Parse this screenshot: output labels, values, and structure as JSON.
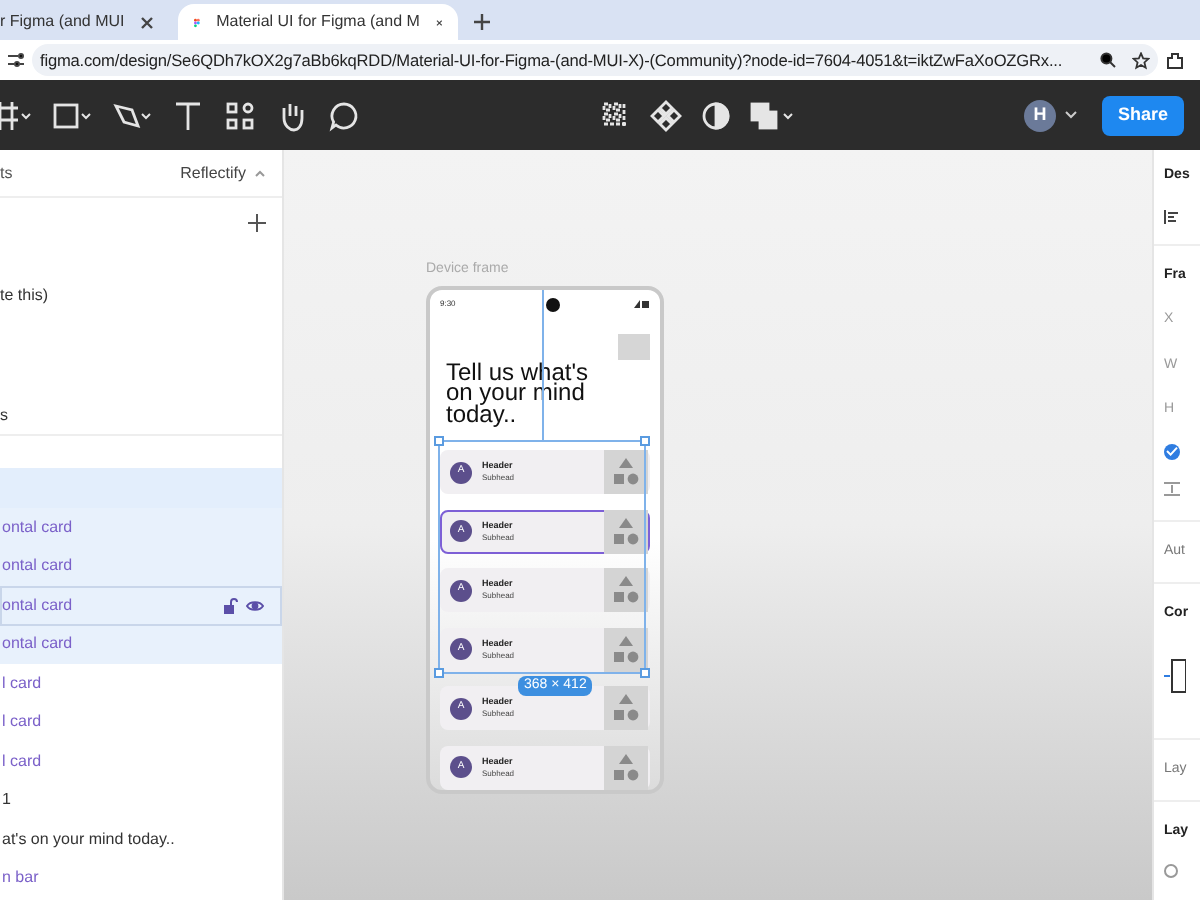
{
  "browser": {
    "tabs": [
      {
        "title": "r Figma (and MUI",
        "selected": false
      },
      {
        "title": "Material UI for Figma (and M",
        "selected": true
      }
    ],
    "url": "figma.com/design/Se6QDh7kOX2g7aBb6kqRDD/Material-UI-for-Figma-(and-MUI-X)-(Community)?node-id=7604-4051&t=iktZwFaXoOZGRx..."
  },
  "toolbar": {
    "avatar": "H",
    "share": "Share"
  },
  "left_panel": {
    "header": "ts",
    "team": "Reflectify",
    "pages": [
      "te this)",
      "s"
    ],
    "layers": [
      {
        "label": "ontal card",
        "kind": "component",
        "selected": true,
        "hovered": false
      },
      {
        "label": "ontal card",
        "kind": "component",
        "selected": true,
        "hovered": false
      },
      {
        "label": "ontal card",
        "kind": "component",
        "selected": true,
        "hovered": true
      },
      {
        "label": "ontal card",
        "kind": "component",
        "selected": true,
        "hovered": false
      },
      {
        "label": "l card",
        "kind": "component",
        "selected": false,
        "hovered": false
      },
      {
        "label": "l card",
        "kind": "component",
        "selected": false,
        "hovered": false
      },
      {
        "label": "l card",
        "kind": "component",
        "selected": false,
        "hovered": false
      },
      {
        "label": "1",
        "kind": "frame",
        "selected": false,
        "hovered": false
      },
      {
        "label": "at's on your mind today..",
        "kind": "text",
        "selected": false,
        "hovered": false
      },
      {
        "label": "n bar",
        "kind": "component",
        "selected": false,
        "hovered": false
      }
    ]
  },
  "canvas": {
    "frame_label": "Device frame",
    "status_time": "9:30",
    "heading": "Tell us what's on your mind today..",
    "size_badge": "368 × 412",
    "cards": [
      {
        "avatar": "A",
        "header": "Header",
        "subhead": "Subhead",
        "selected": false
      },
      {
        "avatar": "A",
        "header": "Header",
        "subhead": "Subhead",
        "selected": true
      },
      {
        "avatar": "A",
        "header": "Header",
        "subhead": "Subhead",
        "selected": false
      },
      {
        "avatar": "A",
        "header": "Header",
        "subhead": "Subhead",
        "selected": false
      },
      {
        "avatar": "A",
        "header": "Header",
        "subhead": "Subhead",
        "selected": false
      },
      {
        "avatar": "A",
        "header": "Header",
        "subhead": "Subhead",
        "selected": false
      }
    ]
  },
  "right_panel": {
    "design": "Des",
    "frame": "Fra",
    "x": "X",
    "w": "W",
    "h": "H",
    "clip_checked": true,
    "auto": "Aut",
    "constraints": "Cor",
    "layout": "Lay",
    "layer": "Lay"
  }
}
